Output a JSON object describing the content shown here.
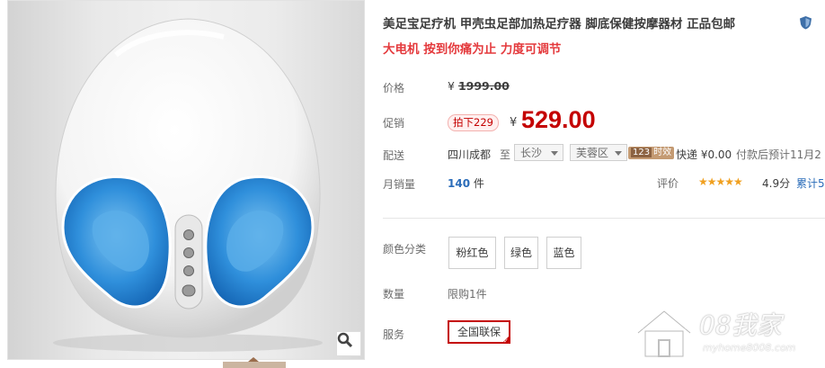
{
  "product": {
    "title": "美足宝足疗机 甲壳虫足部加热足疗器 脚底保健按摩器材 正品包邮",
    "subtitle": "大电机 按到你痛为止 力度可调节"
  },
  "labels": {
    "price": "价格",
    "promo": "促销",
    "delivery": "配送",
    "monthly_sales": "月销量",
    "rating": "评价",
    "color": "颜色分类",
    "quantity": "数量",
    "service": "服务"
  },
  "price": {
    "original_currency": "¥",
    "original": "1999.00",
    "promo_badge": "拍下229",
    "currency": "¥",
    "current": "529.00"
  },
  "delivery": {
    "from": "四川成都",
    "to_label": "至",
    "city": "长沙",
    "district": "芙蓉区",
    "time_badge_num": "123",
    "time_badge_text": "时效",
    "fee": "快递 ¥0.00",
    "note": "付款后预计11月2"
  },
  "sales": {
    "count": "140",
    "unit": "件"
  },
  "rating": {
    "stars": "★★★★★",
    "score": "4.9分",
    "reviews": "累计5"
  },
  "colors": [
    "粉红色",
    "绿色",
    "蓝色"
  ],
  "quantity": {
    "limit": "限购1件"
  },
  "service": {
    "tag": "全国联保"
  },
  "watermark": {
    "brand": "08我家",
    "url": "myhome8008.com"
  },
  "icons": {
    "zoom": "magnifier-icon",
    "shield": "shield-icon"
  },
  "theme": {
    "price_red": "#c40000",
    "promo_red": "#e4393c",
    "link_blue": "#2a6cb9",
    "massager_blue": "#2f8fdb"
  }
}
